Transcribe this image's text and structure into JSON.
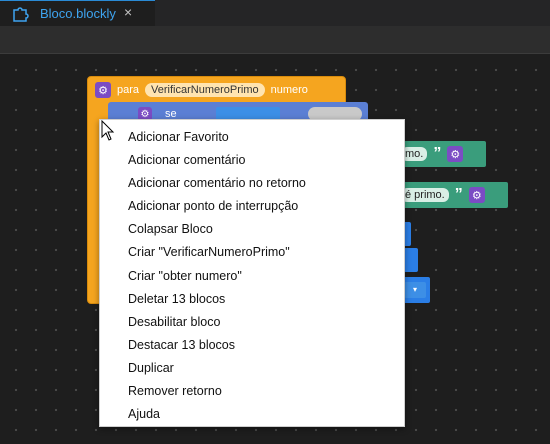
{
  "tab": {
    "title": "Bloco.blockly",
    "close_icon": "×"
  },
  "block": {
    "prefix": "para",
    "name": "VerificarNumeroPrimo",
    "param": "numero",
    "inner_keyword": "se",
    "inner_partial": "é"
  },
  "green_blocks": [
    {
      "text": "mo.",
      "quote": "”"
    },
    {
      "text": "é primo.",
      "quote": "”"
    }
  ],
  "dropdown_glyph": "▾",
  "context_menu": {
    "items": [
      "Adicionar Favorito",
      "Adicionar comentário",
      "Adicionar comentário no retorno",
      "Adicionar ponto de interrupção",
      "Colapsar Bloco",
      "Criar \"VerificarNumeroPrimo\"",
      "Criar \"obter numero\"",
      "Deletar 13 blocos",
      "Desabilitar bloco",
      "Destacar 13 blocos",
      "Duplicar",
      "Remover retorno",
      "Ajuda"
    ]
  },
  "colors": {
    "accent_tab": "#3ea4f0",
    "procedure_block": "#f5a51f",
    "logic_block": "#5b7fd4",
    "text_block": "#3a9d7c",
    "gear": "#7b4cc4"
  },
  "icons": [
    "puzzle-icon",
    "close-icon",
    "gear-icon",
    "mouse-cursor-icon"
  ]
}
